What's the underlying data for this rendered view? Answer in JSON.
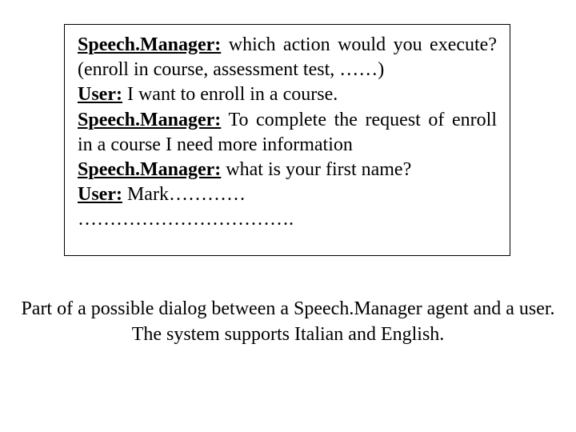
{
  "dialog": {
    "lines": [
      {
        "label": "Speech.Manager:",
        "text": " which action would you execute? (enroll in course, assessment test, ……)",
        "justify": true
      },
      {
        "label": "User:",
        "text": " I want to enroll in a course.",
        "justify": false
      },
      {
        "label": "Speech.Manager:",
        "text": " To complete the request of enroll in a course I need more information",
        "justify": true
      },
      {
        "label": "Speech.Manager:",
        "text": " what is your first name?",
        "justify": false
      },
      {
        "label": "User:",
        "text": " Mark…………",
        "justify": false
      }
    ],
    "trailing": "……………………………."
  },
  "caption": {
    "line1": "Part of a possible dialog between a Speech.Manager agent and a user.",
    "line2": "The system supports Italian and English."
  }
}
